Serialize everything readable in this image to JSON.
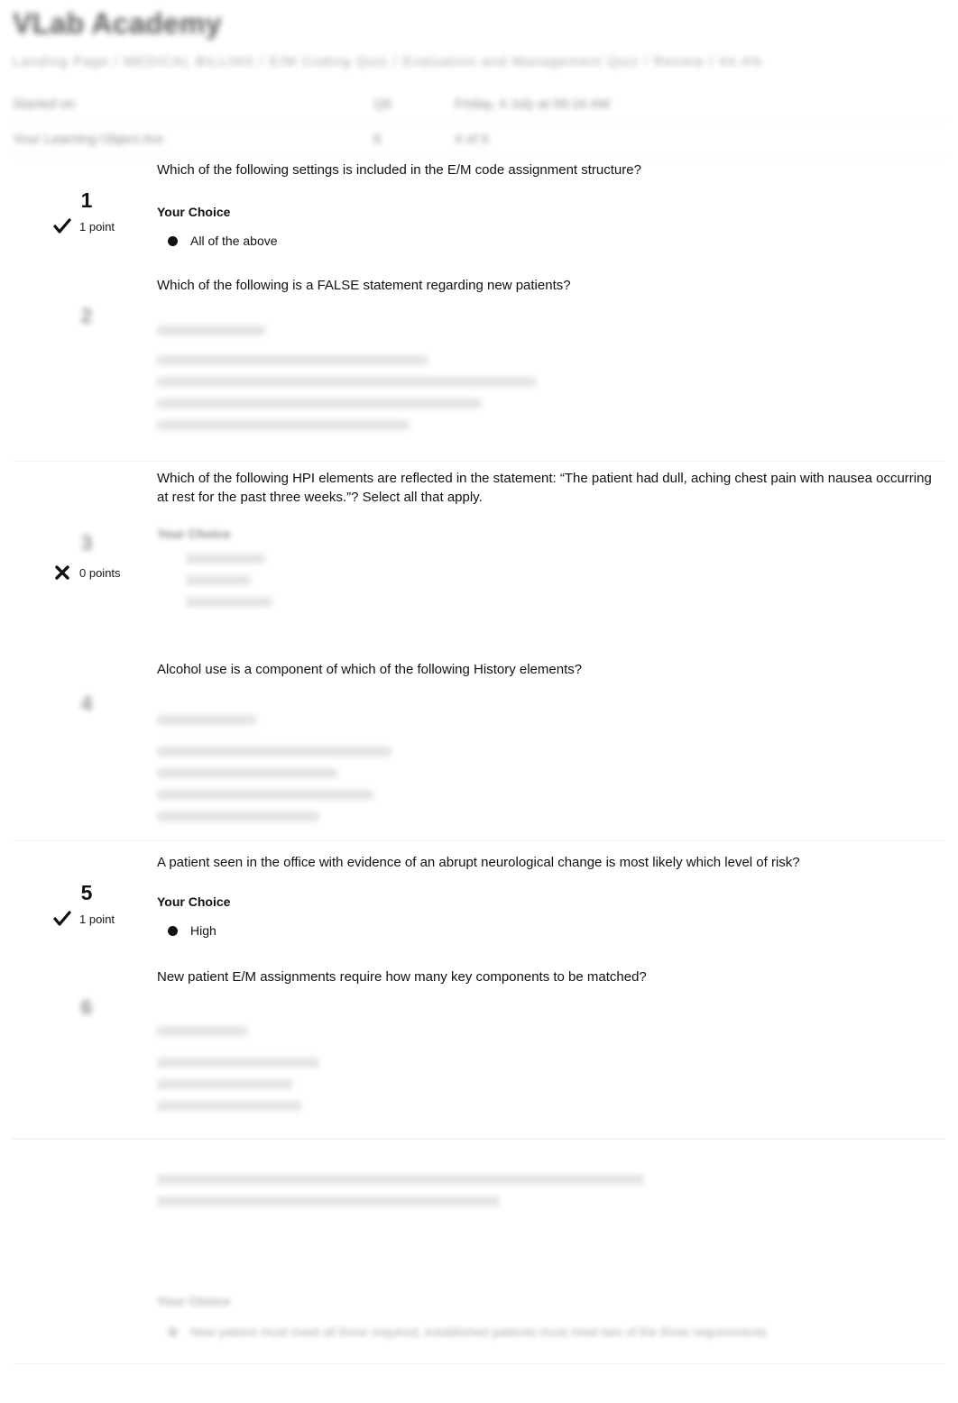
{
  "header": {
    "site_title": "VLab Academy",
    "breadcrumb": "Landing Page / MEDICAL BILLING / E/M Coding Quiz / Evaluation and Management Quiz / Review / 44.4%"
  },
  "summary": {
    "rows": [
      {
        "label": "Started on",
        "mid": "Q6",
        "value": "Friday, 4 July at 09:16 AM"
      },
      {
        "label": "Your Learning Object Are",
        "mid": "6",
        "value": "4 of 9"
      }
    ]
  },
  "questions": [
    {
      "number": "1",
      "mark": "check",
      "points": "1 point",
      "text": "Which of the following settings is included in the E/M code assignment structure?",
      "your_choice_label": "Your Choice",
      "choices": [
        {
          "text": "All of the above",
          "selected": true
        }
      ]
    },
    {
      "number": "2",
      "mark": "none",
      "points": "",
      "text": "Which of the following is a FALSE statement regarding new patients?",
      "your_choice_label": "Your Choice",
      "choices": []
    },
    {
      "number": "3",
      "mark": "cross",
      "points": "0 points",
      "text": "Which of the following HPI elements are reflected in the statement: “The patient had dull, aching chest pain with nausea occurring at rest for the past three weeks.”? Select all that apply.",
      "your_choice_label": "Your Choice",
      "choices": []
    },
    {
      "number": "4",
      "mark": "none",
      "points": "",
      "text": "Alcohol use is a component of which of the following History elements?",
      "your_choice_label": "Your Choice",
      "choices": []
    },
    {
      "number": "5",
      "mark": "check",
      "points": "1 point",
      "text": "A patient seen in the office with evidence of an abrupt neurological change is most likely which level of risk?",
      "your_choice_label": "Your Choice",
      "choices": [
        {
          "text": "High",
          "selected": true
        }
      ]
    },
    {
      "number": "6",
      "mark": "none",
      "points": "",
      "text": "New patient E/M assignments require how many key components to be matched?",
      "your_choice_label": "Your Choice",
      "choices": []
    }
  ],
  "footer": {
    "your_choice_label": "Your Choice",
    "choice_text": "New patient must meet all three required, established patients must meet two of the three requirements"
  },
  "colors": {
    "text": "#111111",
    "rule": "#f4f4f5",
    "bullet": "#111111"
  },
  "icons": {
    "check": "check-icon",
    "cross": "cross-icon"
  }
}
